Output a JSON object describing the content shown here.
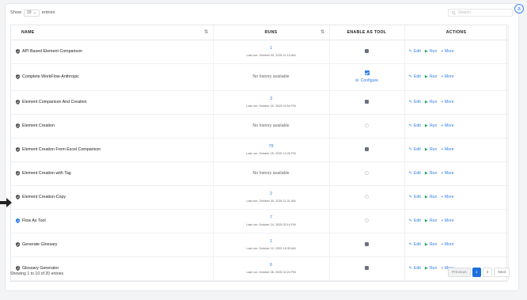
{
  "avatar": {
    "letter": "a"
  },
  "length_control": {
    "prefix": "Show",
    "value": "10",
    "suffix": "entries"
  },
  "search": {
    "placeholder": "Search"
  },
  "table": {
    "columns": [
      {
        "label": "NAME",
        "sortable": true
      },
      {
        "label": "RUNS",
        "sortable": true
      },
      {
        "label": "ENABLE AS TOOL",
        "sortable": false
      },
      {
        "label": "ACTIONS",
        "sortable": false
      }
    ],
    "rows": [
      {
        "name": "API Based Element Comparison",
        "runs": "1",
        "last_run": "Last run: October 09, 2025 11:13 AM",
        "tool": "checked"
      },
      {
        "name": "Complete WorkFlow-Anthropic",
        "runs": "",
        "no_history": "No history available",
        "tool": "active",
        "configure": "Configure"
      },
      {
        "name": "Element Comparison And Creation",
        "runs": "3",
        "last_run": "Last run: October 29, 2025 02:54 PM",
        "tool": "checked"
      },
      {
        "name": "Element Creation",
        "runs": "",
        "no_history": "No history available",
        "tool": "empty"
      },
      {
        "name": "Element Creation From Excel Comparison",
        "runs": "79",
        "last_run": "Last run: October 29, 2025 12:26 PM",
        "tool": "checked"
      },
      {
        "name": "Element Creation with Tag",
        "runs": "",
        "no_history": "No history available",
        "tool": "empty"
      },
      {
        "name": "Element Creation-Copy",
        "runs": "2",
        "last_run": "Last run: October 30, 2025 11:31 AM",
        "tool": "empty"
      },
      {
        "name": "Flow As Tool",
        "runs": "7",
        "last_run": "Last run: October 24, 2025 02:14 PM",
        "tool": "empty"
      },
      {
        "name": "Generate Glossary",
        "runs": "1",
        "last_run": "Last run: October 10, 2025 10:39 AM",
        "tool": "checked"
      },
      {
        "name": "Glossary Generator",
        "runs": "6",
        "last_run": "Last run: October 08, 2025 02:24 PM",
        "tool": "checked"
      }
    ],
    "actions": {
      "edit": "Edit",
      "run": "Run",
      "more": "+ More"
    }
  },
  "footer": {
    "info": "Showing 1 to 10 of 20 entries"
  },
  "pagination": {
    "previous": "Previous",
    "pages": [
      "1",
      "2"
    ],
    "next": "Next"
  },
  "colors": {
    "accent": "#2f7ee8",
    "run": "#22a55a",
    "page_active": "#1d6fe0"
  }
}
